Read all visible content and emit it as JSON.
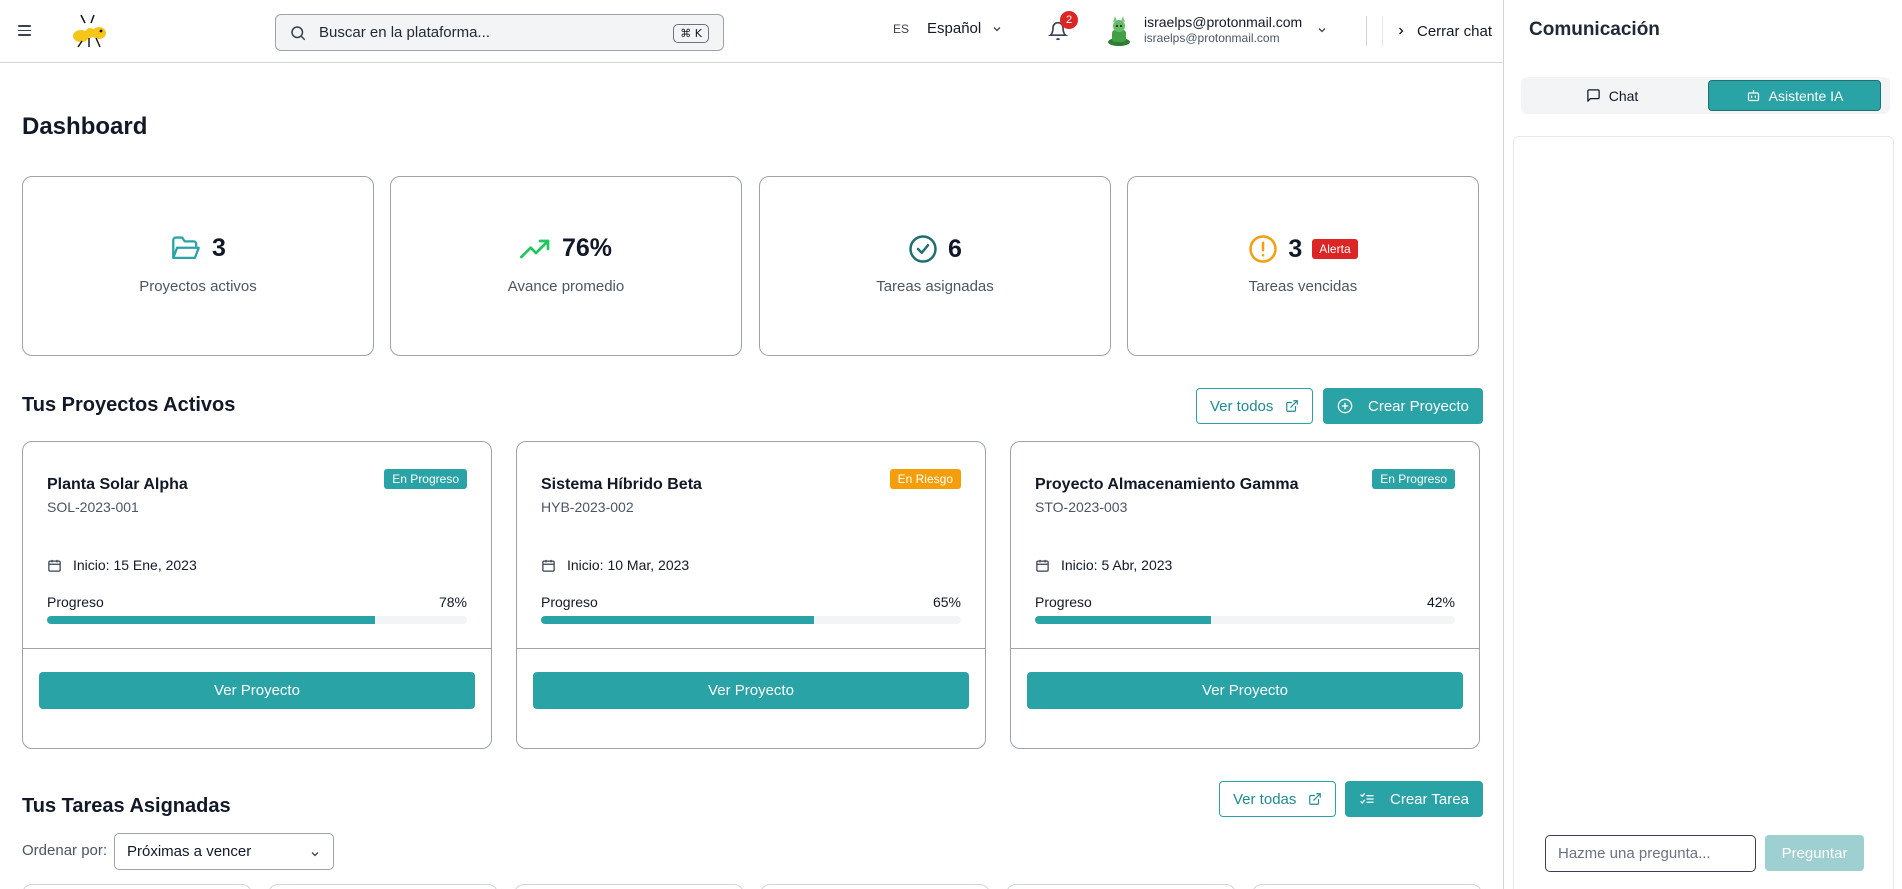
{
  "header": {
    "search_placeholder": "Buscar en la plataforma...",
    "search_shortcut": "⌘ K",
    "language_code": "ES",
    "language_name": "Español",
    "notification_count": "2",
    "user_name": "israelps@protonmail.com",
    "user_email": "israelps@protonmail.com",
    "close_chat_label": "Cerrar chat"
  },
  "main": {
    "title": "Dashboard",
    "stats": [
      {
        "value": "3",
        "label": "Proyectos activos",
        "icon": "folder-open-icon"
      },
      {
        "value": "76%",
        "label": "Avance promedio",
        "icon": "trending-up-icon"
      },
      {
        "value": "6",
        "label": "Tareas asignadas",
        "icon": "check-circle-icon"
      },
      {
        "value": "3",
        "label": "Tareas vencidas",
        "badge": "Alerta",
        "icon": "alert-circle-icon"
      }
    ],
    "projects_section": {
      "title": "Tus Proyectos Activos",
      "view_all_label": "Ver todos",
      "create_label": "Crear Proyecto"
    },
    "projects": [
      {
        "name": "Planta Solar Alpha",
        "code": "SOL-2023-001",
        "status": "En Progreso",
        "status_color": "#2aa3a7",
        "start": "Inicio: 15 Ene, 2023",
        "progress_label": "Progreso",
        "progress_text": "78%",
        "progress": 0.78,
        "button": "Ver Proyecto"
      },
      {
        "name": "Sistema Híbrido Beta",
        "code": "HYB-2023-002",
        "status": "En Riesgo",
        "status_color": "#f59e0b",
        "start": "Inicio: 10 Mar, 2023",
        "progress_label": "Progreso",
        "progress_text": "65%",
        "progress": 0.65,
        "button": "Ver Proyecto"
      },
      {
        "name": "Proyecto Almacenamiento Gamma",
        "code": "STO-2023-003",
        "status": "En Progreso",
        "status_color": "#2aa3a7",
        "start": "Inicio: 5 Abr, 2023",
        "progress_label": "Progreso",
        "progress_text": "42%",
        "progress": 0.42,
        "button": "Ver Proyecto"
      }
    ],
    "tasks_section": {
      "title": "Tus Tareas Asignadas",
      "view_all_label": "Ver todas",
      "create_label": "Crear Tarea",
      "sort_label": "Ordenar por:",
      "sort_value": "Próximas a vencer"
    }
  },
  "panel": {
    "title": "Comunicación",
    "tab_chat": "Chat",
    "tab_ai": "Asistente IA",
    "input_placeholder": "Hazme una pregunta...",
    "ask_button": "Preguntar"
  },
  "colors": {
    "accent": "#2aa3a7",
    "danger": "#dc2626",
    "warning": "#f59e0b",
    "success": "#22c55e"
  }
}
